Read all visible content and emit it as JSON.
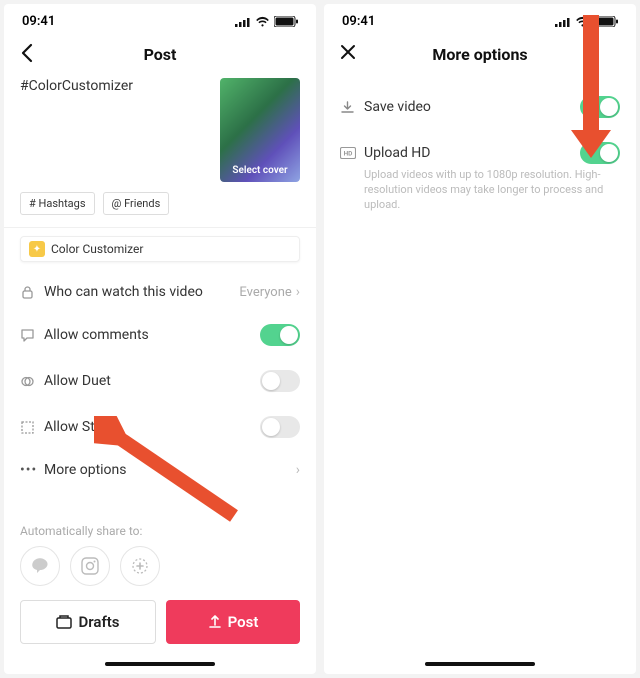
{
  "status": {
    "time": "09:41"
  },
  "left": {
    "title": "Post",
    "caption": "#ColorCustomizer",
    "select_cover": "Select cover",
    "chips": {
      "hashtags": "# Hashtags",
      "friends": "@ Friends"
    },
    "effect": "Color Customizer",
    "privacy": {
      "label": "Who can watch this video",
      "value": "Everyone"
    },
    "comments": {
      "label": "Allow comments"
    },
    "duet": {
      "label": "Allow Duet"
    },
    "stitch": {
      "label": "Allow Stitch"
    },
    "more": {
      "label": "More options"
    },
    "share_label": "Automatically share to:",
    "buttons": {
      "drafts": "Drafts",
      "post": "Post"
    }
  },
  "right": {
    "title": "More options",
    "save": {
      "label": "Save video"
    },
    "hd": {
      "label": "Upload HD",
      "desc": "Upload videos with up to 1080p resolution. High-resolution videos may take longer to process and upload."
    }
  }
}
